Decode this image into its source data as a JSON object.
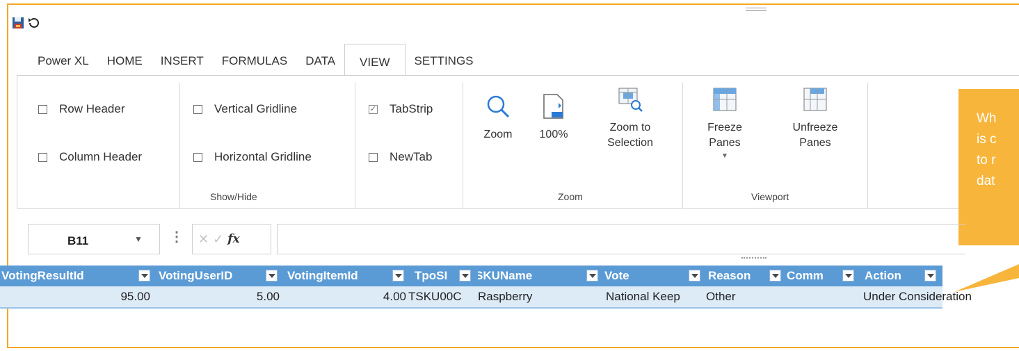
{
  "ribbon_tabs": [
    "Power XL",
    "HOME",
    "INSERT",
    "FORMULAS",
    "DATA",
    "VIEW",
    "SETTINGS"
  ],
  "active_tab": "VIEW",
  "show_hide": {
    "row_header": "Row Header",
    "column_header": "Column Header",
    "vertical_gridline": "Vertical Gridline",
    "horizontal_gridline": "Horizontal Gridline",
    "tabstrip": "TabStrip",
    "tabstrip_checked": true,
    "newtab": "NewTab",
    "group_label": "Show/Hide"
  },
  "zoom_group": {
    "zoom": "Zoom",
    "hundred": "100%",
    "zoom_to_selection": "Zoom to\nSelection",
    "group_label": "Zoom"
  },
  "viewport_group": {
    "freeze": "Freeze\nPanes",
    "unfreeze": "Unfreeze\nPanes",
    "group_label": "Viewport"
  },
  "callout_lines": [
    "Wh",
    "is c",
    "to r",
    "dat"
  ],
  "formula_bar": {
    "name_box": "B11",
    "fx": "fx",
    "formula": ""
  },
  "table": {
    "headers": [
      "VotingResultId",
      "VotingUserID",
      "VotingItemId",
      "TpoSI",
      "SKUName",
      "Vote",
      "Reason",
      "Comm",
      "Action"
    ],
    "row": [
      "95.00",
      "5.00",
      "4.00",
      "TSKU00C",
      "Raspberry",
      "National Keep",
      "Other",
      "",
      "Under Consideration"
    ]
  },
  "colors": {
    "accent_border": "#f5a623",
    "callout": "#f8b53b",
    "table_header": "#5b9bd5",
    "table_row": "#ddebf7"
  }
}
